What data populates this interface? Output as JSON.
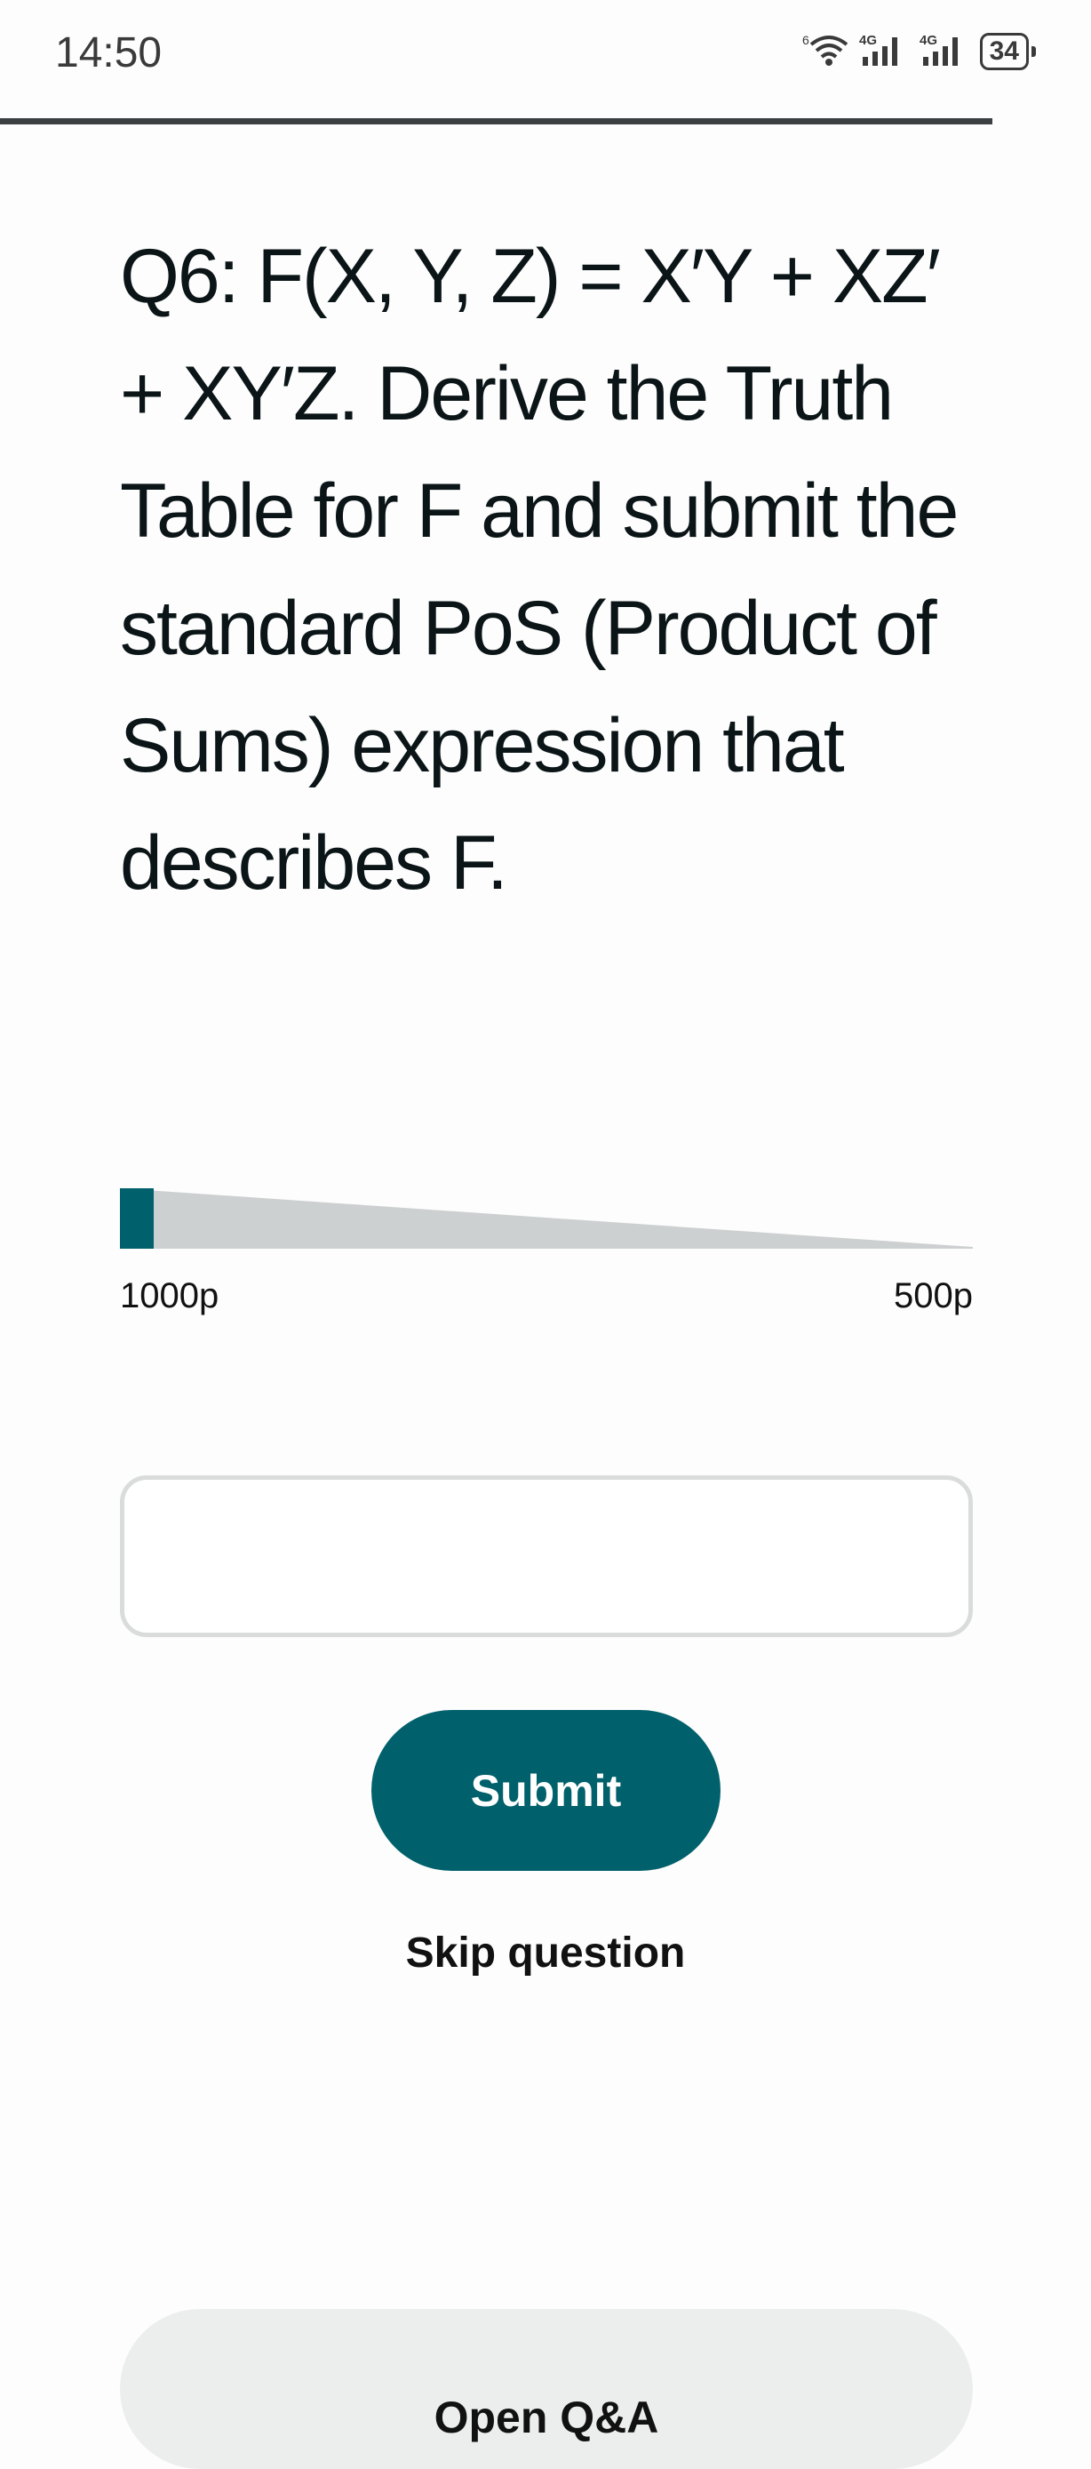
{
  "status_bar": {
    "time": "14:50",
    "wifi_badge": "6",
    "signal_1_label": "4G",
    "signal_2_label": "4G",
    "battery_level": "34",
    "icons": [
      "wifi-icon",
      "signal-icon",
      "signal-icon",
      "battery-icon"
    ]
  },
  "quiz": {
    "progress_fraction": 0.91,
    "question": "Q6: F(X, Y, Z) = X′Y + XZ′ + XY′Z. Derive the Truth Table for F and submit the standard PoS (Product of Sums) expression that describes F.",
    "points": {
      "start_label": "1000p",
      "end_label": "500p",
      "elapsed_fraction": 0.04
    },
    "answer": {
      "value": "",
      "placeholder": ""
    },
    "submit_label": "Submit",
    "skip_label": "Skip question",
    "open_qa_label": "Open Q&A"
  },
  "colors": {
    "accent": "#00606b",
    "meter_track": "#cdd0d1",
    "secondary_button": "#eceeee"
  }
}
